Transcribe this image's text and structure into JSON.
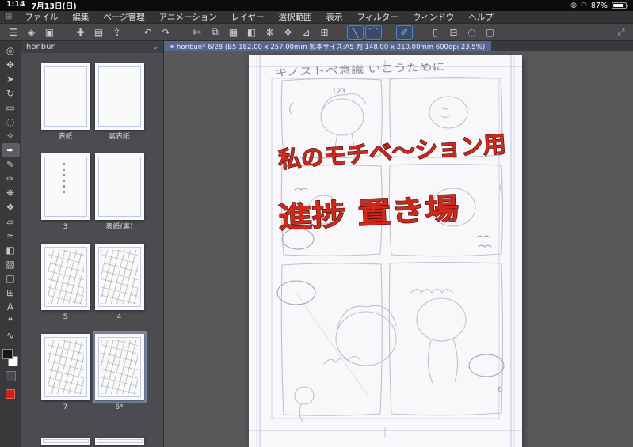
{
  "status_bar": {
    "time": "1:14",
    "date": "7月13日(日)",
    "battery_percent": "87%"
  },
  "menu_bar": {
    "items": [
      {
        "label": "ファイル"
      },
      {
        "label": "編集"
      },
      {
        "label": "ページ管理"
      },
      {
        "label": "アニメーション"
      },
      {
        "label": "レイヤー"
      },
      {
        "label": "選択範囲"
      },
      {
        "label": "表示"
      },
      {
        "label": "フィルター"
      },
      {
        "label": "ウィンドウ"
      },
      {
        "label": "ヘルプ"
      }
    ]
  },
  "toolbar": {
    "icons": [
      {
        "name": "main-menu-icon",
        "glyph": "☰",
        "classes": ""
      },
      {
        "name": "tool-switch-icon",
        "glyph": "◈",
        "classes": ""
      },
      {
        "name": "camera-icon",
        "glyph": "▣",
        "classes": ""
      },
      {
        "name": "new-page-icon",
        "glyph": "✚",
        "classes": "gap"
      },
      {
        "name": "folder-icon",
        "glyph": "▤",
        "classes": ""
      },
      {
        "name": "export-icon",
        "glyph": "⇪",
        "classes": ""
      },
      {
        "name": "undo-icon",
        "glyph": "↶",
        "classes": "gap"
      },
      {
        "name": "redo-icon",
        "glyph": "↷",
        "classes": ""
      },
      {
        "name": "cut-icon",
        "glyph": "✄",
        "classes": "gap"
      },
      {
        "name": "copy-icon",
        "glyph": "⧉",
        "classes": ""
      },
      {
        "name": "paste-icon",
        "glyph": "▦",
        "classes": ""
      },
      {
        "name": "fill-icon",
        "glyph": "◧",
        "classes": ""
      },
      {
        "name": "spray-icon",
        "glyph": "❋",
        "classes": ""
      },
      {
        "name": "material-icon",
        "glyph": "❖",
        "classes": ""
      },
      {
        "name": "ruler-icon",
        "glyph": "⊿",
        "classes": ""
      },
      {
        "name": "grid-icon",
        "glyph": "⊞",
        "classes": ""
      },
      {
        "name": "straight-line-icon",
        "glyph": "╲",
        "classes": "gap active"
      },
      {
        "name": "curve-line-icon",
        "glyph": "⌒",
        "classes": "active"
      },
      {
        "name": "stroke-line-icon",
        "glyph": "✐",
        "classes": "gap active"
      },
      {
        "name": "page-icon",
        "glyph": "▯",
        "classes": "gap"
      },
      {
        "name": "frame-border-icon",
        "glyph": "⊟",
        "classes": ""
      },
      {
        "name": "lasso-icon",
        "glyph": "◌",
        "classes": ""
      },
      {
        "name": "empty-slot-icon",
        "glyph": "▢",
        "classes": ""
      }
    ],
    "collapse_icon_glyph": "⤢"
  },
  "tool_column": {
    "tools": [
      {
        "name": "zoom-tool",
        "glyph": "◎",
        "classes": ""
      },
      {
        "name": "move-tool",
        "glyph": "✥",
        "classes": ""
      },
      {
        "name": "operation-tool",
        "glyph": "➤",
        "classes": ""
      },
      {
        "name": "rotate-tool",
        "glyph": "↻",
        "classes": ""
      },
      {
        "name": "selection-tool",
        "glyph": "▭",
        "classes": ""
      },
      {
        "name": "lasso-tool",
        "glyph": "◌",
        "classes": ""
      },
      {
        "name": "eyedropper-tool",
        "glyph": "✧",
        "classes": ""
      },
      {
        "name": "pen-tool",
        "glyph": "✒",
        "classes": "active"
      },
      {
        "name": "pencil-tool",
        "glyph": "✎",
        "classes": ""
      },
      {
        "name": "brush-tool",
        "glyph": "✑",
        "classes": ""
      },
      {
        "name": "airbrush-tool",
        "glyph": "❋",
        "classes": ""
      },
      {
        "name": "decoration-tool",
        "glyph": "❖",
        "classes": ""
      },
      {
        "name": "eraser-tool",
        "glyph": "▱",
        "classes": ""
      },
      {
        "name": "blend-tool",
        "glyph": "≈",
        "classes": ""
      },
      {
        "name": "fill-tool",
        "glyph": "◧",
        "classes": ""
      },
      {
        "name": "gradient-tool",
        "glyph": "▨",
        "classes": ""
      },
      {
        "name": "figure-tool",
        "glyph": "□",
        "classes": ""
      },
      {
        "name": "frame-tool",
        "glyph": "⊞",
        "classes": ""
      },
      {
        "name": "text-tool",
        "glyph": "A",
        "classes": ""
      },
      {
        "name": "balloon-tool",
        "glyph": "❝",
        "classes": ""
      },
      {
        "name": "correction-tool",
        "glyph": "∿",
        "classes": ""
      }
    ],
    "color_chips": {
      "main": "#161616",
      "sub": "#ffffff",
      "current": "#c8241c"
    }
  },
  "page_panel": {
    "title": "honbun",
    "spreads": [
      {
        "pages": [
          {
            "label": "表紙",
            "classes": "blank"
          },
          {
            "label": "裏表紙",
            "classes": "blank"
          }
        ]
      },
      {
        "pages": [
          {
            "label": "3",
            "classes": "textpage"
          },
          {
            "label": "表紙(裏)",
            "classes": "blank"
          }
        ]
      },
      {
        "pages": [
          {
            "label": "5",
            "classes": "sketch"
          },
          {
            "label": "4",
            "classes": "sketch"
          }
        ]
      },
      {
        "pages": [
          {
            "label": "7",
            "classes": "sketch"
          },
          {
            "label": "6*",
            "classes": "sketch selected"
          }
        ]
      }
    ]
  },
  "document_tab": {
    "title": "honbun* 6/28 (B5 182.00 x 257.00mm 製本サイズ:A5 判 148.00 x 210.00mm 600dpi 23.5%)"
  },
  "canvas": {
    "pencil_note": "キノストペ意識 いこうために",
    "small_note": "123",
    "red_text_line1": "私のモチベ〜ション用",
    "red_text_line2": "進捗 置き場",
    "page_number": "6"
  },
  "colors": {
    "accent_blue": "#56668c",
    "marker_red": "#d2281c",
    "guide_blue": "#a4b4da",
    "selection_highlight": "#7e89a7"
  }
}
